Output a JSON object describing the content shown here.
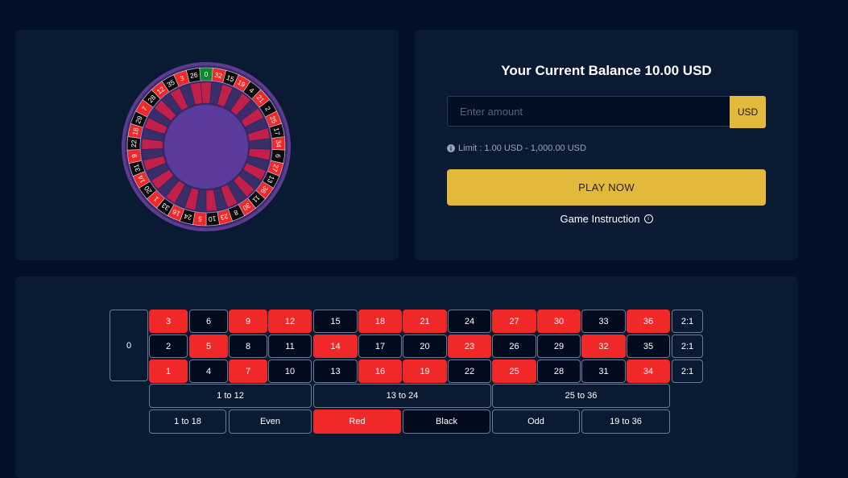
{
  "wheel": {
    "sequence": [
      "0",
      "32",
      "15",
      "19",
      "4",
      "21",
      "2",
      "25",
      "17",
      "34",
      "6",
      "27",
      "13",
      "36",
      "11",
      "30",
      "8",
      "23",
      "10",
      "5",
      "24",
      "16",
      "33",
      "1",
      "20",
      "14",
      "31",
      "9",
      "22",
      "18",
      "29",
      "7",
      "28",
      "12",
      "35",
      "3",
      "26"
    ],
    "colors": {
      "red": "#f02828",
      "black": "#0a0a0a",
      "green": "#0c8a2c",
      "rim": "#5b3c8f",
      "center": "#5a3a9a",
      "inner_red": "#c0204a",
      "inner_dark": "#3a2e6a"
    }
  },
  "play": {
    "balance_text": "Your Current Balance 10.00 USD",
    "amount_placeholder": "Enter amount",
    "currency": "USD",
    "limit_icon": "i",
    "limit_text": "Limit : 1.00 USD - 1,000.00 USD",
    "play_label": "PLAY NOW",
    "instruction_label": "Game Instruction",
    "instruction_icon": "i"
  },
  "board": {
    "zero": "0",
    "rows": [
      [
        {
          "n": "3",
          "c": "red"
        },
        {
          "n": "6",
          "c": "black"
        },
        {
          "n": "9",
          "c": "red"
        },
        {
          "n": "12",
          "c": "red"
        },
        {
          "n": "15",
          "c": "black"
        },
        {
          "n": "18",
          "c": "red"
        },
        {
          "n": "21",
          "c": "red"
        },
        {
          "n": "24",
          "c": "black"
        },
        {
          "n": "27",
          "c": "red"
        },
        {
          "n": "30",
          "c": "red"
        },
        {
          "n": "33",
          "c": "black"
        },
        {
          "n": "36",
          "c": "red"
        }
      ],
      [
        {
          "n": "2",
          "c": "black"
        },
        {
          "n": "5",
          "c": "red"
        },
        {
          "n": "8",
          "c": "black"
        },
        {
          "n": "11",
          "c": "black"
        },
        {
          "n": "14",
          "c": "red"
        },
        {
          "n": "17",
          "c": "black"
        },
        {
          "n": "20",
          "c": "black"
        },
        {
          "n": "23",
          "c": "red"
        },
        {
          "n": "26",
          "c": "black"
        },
        {
          "n": "29",
          "c": "black"
        },
        {
          "n": "32",
          "c": "red"
        },
        {
          "n": "35",
          "c": "black"
        }
      ],
      [
        {
          "n": "1",
          "c": "red"
        },
        {
          "n": "4",
          "c": "black"
        },
        {
          "n": "7",
          "c": "red"
        },
        {
          "n": "10",
          "c": "black"
        },
        {
          "n": "13",
          "c": "black"
        },
        {
          "n": "16",
          "c": "red"
        },
        {
          "n": "19",
          "c": "red"
        },
        {
          "n": "22",
          "c": "black"
        },
        {
          "n": "25",
          "c": "red"
        },
        {
          "n": "28",
          "c": "black"
        },
        {
          "n": "31",
          "c": "black"
        },
        {
          "n": "34",
          "c": "red"
        }
      ]
    ],
    "column_bets": [
      "2:1",
      "2:1",
      "2:1"
    ],
    "dozens": [
      "1 to 12",
      "13 to 24",
      "25 to 36"
    ],
    "outside": [
      {
        "label": "1 to 18",
        "c": "blue"
      },
      {
        "label": "Even",
        "c": "blue"
      },
      {
        "label": "Red",
        "c": "red"
      },
      {
        "label": "Black",
        "c": "black"
      },
      {
        "label": "Odd",
        "c": "blue"
      },
      {
        "label": "19 to 36",
        "c": "blue"
      }
    ]
  }
}
